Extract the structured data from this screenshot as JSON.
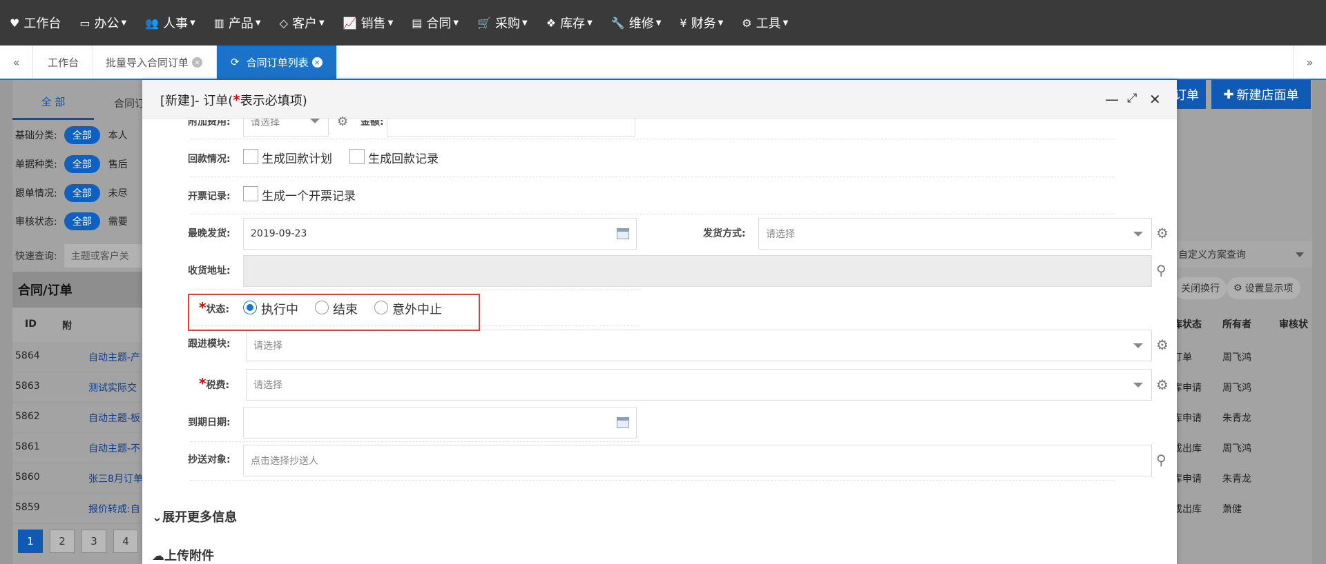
{
  "topnav": {
    "items": [
      {
        "icon": "heart-icon",
        "glyph": "♥",
        "label": "工作台",
        "caret": false
      },
      {
        "icon": "laptop-icon",
        "glyph": "▭",
        "label": "办公",
        "caret": true
      },
      {
        "icon": "users-icon",
        "glyph": "👥",
        "label": "人事",
        "caret": true
      },
      {
        "icon": "barcode-icon",
        "glyph": "▥",
        "label": "产品",
        "caret": true
      },
      {
        "icon": "diamond-icon",
        "glyph": "◇",
        "label": "客户",
        "caret": true
      },
      {
        "icon": "line-chart-icon",
        "glyph": "📈",
        "label": "销售",
        "caret": true
      },
      {
        "icon": "contract-icon",
        "glyph": "▤",
        "label": "合同",
        "caret": true
      },
      {
        "icon": "cart-icon",
        "glyph": "🛒",
        "label": "采购",
        "caret": true
      },
      {
        "icon": "cubes-icon",
        "glyph": "❖",
        "label": "库存",
        "caret": true
      },
      {
        "icon": "wrench-icon",
        "glyph": "🔧",
        "label": "维修",
        "caret": true
      },
      {
        "icon": "yen-icon",
        "glyph": "¥",
        "label": "财务",
        "caret": true
      },
      {
        "icon": "gear-icon",
        "glyph": "⚙",
        "label": "工具",
        "caret": true
      }
    ]
  },
  "tabs": [
    {
      "label": "工作台",
      "closable": false,
      "active": false
    },
    {
      "label": "批量导入合同订单",
      "closable": true,
      "active": false
    },
    {
      "label": "合同订单列表",
      "closable": true,
      "active": true
    }
  ],
  "background": {
    "subtabs": [
      "全 部",
      "合同订单"
    ],
    "filters": [
      {
        "label": "基础分类:",
        "pill": "全部",
        "next": "本人"
      },
      {
        "label": "单据种类:",
        "pill": "全部",
        "next": "售后"
      },
      {
        "label": "跟单情况:",
        "pill": "全部",
        "next": "未尽"
      },
      {
        "label": "审核状态:",
        "pill": "全部",
        "next": "需要"
      }
    ],
    "quick_search_label": "快速查询:",
    "quick_search_placeholder": "主题或客户关",
    "table_title": "合同/订单",
    "columns": [
      "ID",
      "附"
    ],
    "rows": [
      {
        "id": "5864",
        "name": "自动主题-产"
      },
      {
        "id": "5863",
        "name": "测试实际交"
      },
      {
        "id": "5862",
        "name": "自动主题-板"
      },
      {
        "id": "5861",
        "name": "自动主题-不"
      },
      {
        "id": "5860",
        "name": "张三8月订单"
      },
      {
        "id": "5859",
        "name": "报价转成:自"
      }
    ],
    "right_buttons": [
      "订单",
      "新建店面单"
    ],
    "custom_query": "自定义方案查询",
    "close_wrap": "关闭换行",
    "display_settings": "设置显示项",
    "right_columns": [
      "库状态",
      "所有者",
      "审核状"
    ],
    "right_rows": [
      {
        "status": "订单",
        "owner": "周飞鸿"
      },
      {
        "status": "库申请",
        "owner": "周飞鸿"
      },
      {
        "status": "库申请",
        "owner": "朱青龙"
      },
      {
        "status": "成出库",
        "owner": "周飞鸿"
      },
      {
        "status": "库申请",
        "owner": "朱青龙"
      },
      {
        "status": "成出库",
        "owner": "萧健"
      }
    ],
    "pages": [
      "1",
      "2",
      "3",
      "4"
    ]
  },
  "modal": {
    "title_prefix": "[新建]- 订单(",
    "title_star": "*",
    "title_suffix": "表示必填项)",
    "fields": {
      "extra_fee_label": "附加费用:",
      "extra_fee_placeholder": "请选择",
      "amount_label": "金额:",
      "payment_label": "回款情况:",
      "payment_plan": "生成回款计划",
      "payment_record": "生成回款记录",
      "invoice_label": "开票记录:",
      "invoice_record": "生成一个开票记录",
      "latest_ship_label": "最晚发货:",
      "latest_ship_value": "2019-09-23",
      "ship_method_label": "发货方式:",
      "ship_method_placeholder": "请选择",
      "address_label": "收货地址:",
      "status_label": "状态:",
      "status_options": [
        "执行中",
        "结束",
        "意外中止"
      ],
      "status_selected": "执行中",
      "follow_label": "跟进模块:",
      "follow_placeholder": "请选择",
      "tax_label": "税费:",
      "tax_placeholder": "请选择",
      "due_label": "到期日期:",
      "cc_label": "抄送对象:",
      "cc_placeholder": "点击选择抄送人"
    },
    "expand_more": "展开更多信息",
    "upload": "上传附件"
  }
}
